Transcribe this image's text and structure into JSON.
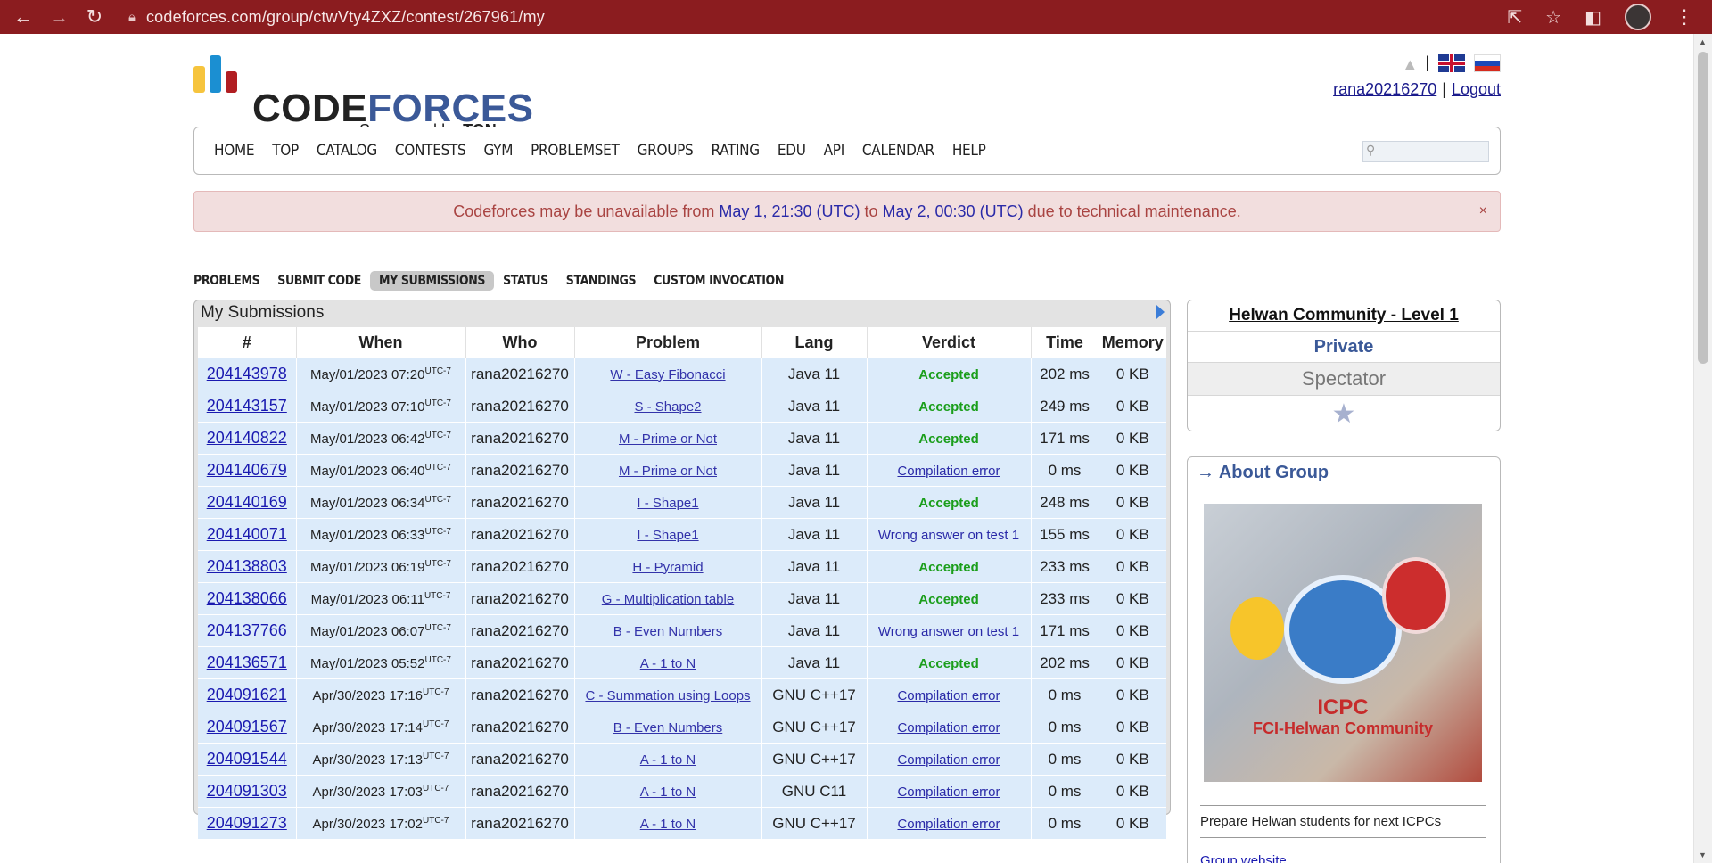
{
  "browser": {
    "url": "codeforces.com/group/ctwVty4ZXZ/contest/267961/my"
  },
  "header": {
    "logo_code": "CODE",
    "logo_forces": "FORCES",
    "sponsor_prefix": "Sponsored by",
    "sponsor_name": "TON",
    "username": "rana20216270",
    "logout": "Logout",
    "pipe": "|"
  },
  "menu": {
    "items": [
      "HOME",
      "TOP",
      "CATALOG",
      "CONTESTS",
      "GYM",
      "PROBLEMSET",
      "GROUPS",
      "RATING",
      "EDU",
      "API",
      "CALENDAR",
      "HELP"
    ]
  },
  "alert": {
    "text_before": "Codeforces may be unavailable from",
    "link1": "May 1, 21:30 (UTC)",
    "text_mid": "to",
    "link2": "May 2, 00:30 (UTC)",
    "text_after": "due to technical maintenance.",
    "close": "×"
  },
  "subnav": {
    "items": [
      "PROBLEMS",
      "SUBMIT CODE",
      "MY SUBMISSIONS",
      "STATUS",
      "STANDINGS",
      "CUSTOM INVOCATION"
    ],
    "active": "MY SUBMISSIONS"
  },
  "submissions": {
    "title": "My Submissions",
    "columns": [
      "#",
      "When",
      "Who",
      "Problem",
      "Lang",
      "Verdict",
      "Time",
      "Memory"
    ],
    "tz": "UTC-7",
    "rows": [
      {
        "id": "204143978",
        "when": "May/01/2023 07:20",
        "who": "rana20216270",
        "problem": "W - Easy Fibonacci",
        "lang": "Java 11",
        "verdict": "Accepted",
        "vtype": "acc",
        "time": "202 ms",
        "memory": "0 KB"
      },
      {
        "id": "204143157",
        "when": "May/01/2023 07:10",
        "who": "rana20216270",
        "problem": "S - Shape2",
        "lang": "Java 11",
        "verdict": "Accepted",
        "vtype": "acc",
        "time": "249 ms",
        "memory": "0 KB"
      },
      {
        "id": "204140822",
        "when": "May/01/2023 06:42",
        "who": "rana20216270",
        "problem": "M - Prime or Not",
        "lang": "Java 11",
        "verdict": "Accepted",
        "vtype": "acc",
        "time": "171 ms",
        "memory": "0 KB"
      },
      {
        "id": "204140679",
        "when": "May/01/2023 06:40",
        "who": "rana20216270",
        "problem": "M - Prime or Not",
        "lang": "Java 11",
        "verdict": "Compilation error",
        "vtype": "ce",
        "time": "0 ms",
        "memory": "0 KB"
      },
      {
        "id": "204140169",
        "when": "May/01/2023 06:34",
        "who": "rana20216270",
        "problem": "I - Shape1",
        "lang": "Java 11",
        "verdict": "Accepted",
        "vtype": "acc",
        "time": "248 ms",
        "memory": "0 KB"
      },
      {
        "id": "204140071",
        "when": "May/01/2023 06:33",
        "who": "rana20216270",
        "problem": "I - Shape1",
        "lang": "Java 11",
        "verdict": "Wrong answer on test 1",
        "vtype": "wa",
        "time": "155 ms",
        "memory": "0 KB"
      },
      {
        "id": "204138803",
        "when": "May/01/2023 06:19",
        "who": "rana20216270",
        "problem": "H - Pyramid",
        "lang": "Java 11",
        "verdict": "Accepted",
        "vtype": "acc",
        "time": "233 ms",
        "memory": "0 KB"
      },
      {
        "id": "204138066",
        "when": "May/01/2023 06:11",
        "who": "rana20216270",
        "problem": "G - Multiplication table",
        "lang": "Java 11",
        "verdict": "Accepted",
        "vtype": "acc",
        "time": "233 ms",
        "memory": "0 KB"
      },
      {
        "id": "204137766",
        "when": "May/01/2023 06:07",
        "who": "rana20216270",
        "problem": "B - Even Numbers",
        "lang": "Java 11",
        "verdict": "Wrong answer on test 1",
        "vtype": "wa",
        "time": "171 ms",
        "memory": "0 KB"
      },
      {
        "id": "204136571",
        "when": "May/01/2023 05:52",
        "who": "rana20216270",
        "problem": "A - 1 to N",
        "lang": "Java 11",
        "verdict": "Accepted",
        "vtype": "acc",
        "time": "202 ms",
        "memory": "0 KB"
      },
      {
        "id": "204091621",
        "when": "Apr/30/2023 17:16",
        "who": "rana20216270",
        "problem": "C - Summation using Loops",
        "lang": "GNU C++17",
        "verdict": "Compilation error",
        "vtype": "ce",
        "time": "0 ms",
        "memory": "0 KB"
      },
      {
        "id": "204091567",
        "when": "Apr/30/2023 17:14",
        "who": "rana20216270",
        "problem": "B - Even Numbers",
        "lang": "GNU C++17",
        "verdict": "Compilation error",
        "vtype": "ce",
        "time": "0 ms",
        "memory": "0 KB"
      },
      {
        "id": "204091544",
        "when": "Apr/30/2023 17:13",
        "who": "rana20216270",
        "problem": "A - 1 to N",
        "lang": "GNU C++17",
        "verdict": "Compilation error",
        "vtype": "ce",
        "time": "0 ms",
        "memory": "0 KB"
      },
      {
        "id": "204091303",
        "when": "Apr/30/2023 17:03",
        "who": "rana20216270",
        "problem": "A - 1 to N",
        "lang": "GNU C11",
        "verdict": "Compilation error",
        "vtype": "ce",
        "time": "0 ms",
        "memory": "0 KB"
      },
      {
        "id": "204091273",
        "when": "Apr/30/2023 17:02",
        "who": "rana20216270",
        "problem": "A - 1 to N",
        "lang": "GNU C++17",
        "verdict": "Compilation error",
        "vtype": "ce",
        "time": "0 ms",
        "memory": "0 KB"
      }
    ]
  },
  "sidebar": {
    "group_name": "Helwan Community - Level 1",
    "privacy": "Private",
    "role": "Spectator",
    "about_title": "About Group",
    "about_arrow": "→",
    "image_text_1": "ICPC",
    "image_text_2": "FCI-Helwan Community",
    "description": "Prepare Helwan students for next ICPCs",
    "website": "Group website"
  },
  "colors": {
    "chrome": "#8b1c1f",
    "accepted": "#1b9e1b",
    "row_bg": "#dcebfa",
    "alert_bg": "#f2dede"
  }
}
